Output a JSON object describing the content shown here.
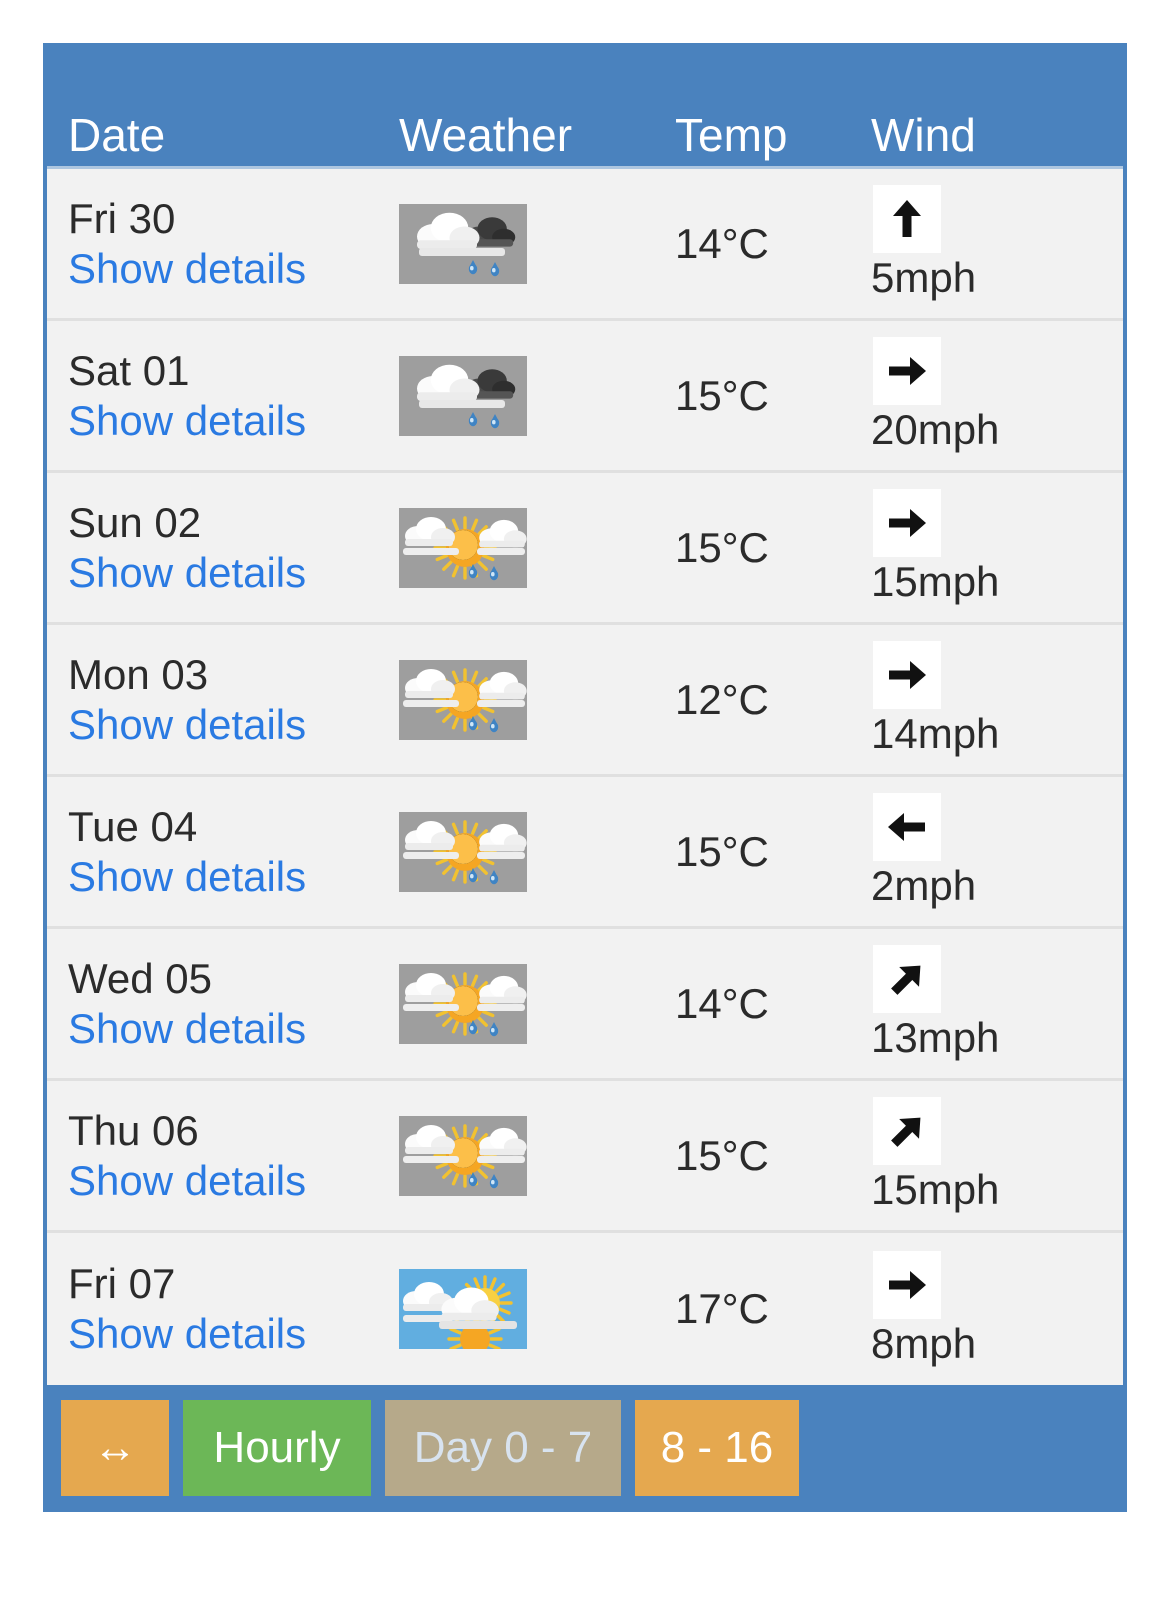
{
  "colors": {
    "header_bg": "#4a82be",
    "row_bg": "#f2f2f2",
    "link": "#2a7ae2",
    "orange": "#e5a84f",
    "green": "#6cb757",
    "tan": "#b6a98a"
  },
  "table": {
    "columns": [
      {
        "key": "date",
        "label": "Date"
      },
      {
        "key": "weather",
        "label": "Weather"
      },
      {
        "key": "temp",
        "label": "Temp"
      },
      {
        "key": "wind",
        "label": "Wind"
      }
    ],
    "rows": [
      {
        "date": "Fri 30",
        "details_label": "Show details",
        "weather_icon": "cloud-rain-icon",
        "temp": "14°C",
        "wind_icon": "arrow-up-icon",
        "wind_direction": "up",
        "wind_speed": "5mph"
      },
      {
        "date": "Sat 01",
        "details_label": "Show details",
        "weather_icon": "cloud-rain-icon",
        "temp": "15°C",
        "wind_icon": "arrow-right-icon",
        "wind_direction": "right",
        "wind_speed": "20mph"
      },
      {
        "date": "Sun 02",
        "details_label": "Show details",
        "weather_icon": "sun-cloud-rain-icon",
        "temp": "15°C",
        "wind_icon": "arrow-right-icon",
        "wind_direction": "right",
        "wind_speed": "15mph"
      },
      {
        "date": "Mon 03",
        "details_label": "Show details",
        "weather_icon": "sun-cloud-rain-icon",
        "temp": "12°C",
        "wind_icon": "arrow-right-icon",
        "wind_direction": "right",
        "wind_speed": "14mph"
      },
      {
        "date": "Tue 04",
        "details_label": "Show details",
        "weather_icon": "sun-cloud-rain-icon",
        "temp": "15°C",
        "wind_icon": "arrow-left-icon",
        "wind_direction": "left",
        "wind_speed": "2mph"
      },
      {
        "date": "Wed 05",
        "details_label": "Show details",
        "weather_icon": "sun-cloud-rain-icon",
        "temp": "14°C",
        "wind_icon": "arrow-up-right-icon",
        "wind_direction": "up-right",
        "wind_speed": "13mph"
      },
      {
        "date": "Thu 06",
        "details_label": "Show details",
        "weather_icon": "sun-cloud-rain-icon",
        "temp": "15°C",
        "wind_icon": "arrow-up-right-icon",
        "wind_direction": "up-right",
        "wind_speed": "15mph"
      },
      {
        "date": "Fri 07",
        "details_label": "Show details",
        "weather_icon": "sun-cloud-partly-icon",
        "temp": "17°C",
        "wind_icon": "arrow-right-icon",
        "wind_direction": "right",
        "wind_speed": "8mph"
      }
    ]
  },
  "footer": {
    "buttons": [
      {
        "name": "resize-button",
        "label": "↔",
        "icon": "resize-horizontal-icon",
        "style": "orange"
      },
      {
        "name": "hourly-button",
        "label": "Hourly",
        "icon": "",
        "style": "green"
      },
      {
        "name": "day-0-7-button",
        "label": "Day 0 - 7",
        "icon": "",
        "style": "tan"
      },
      {
        "name": "day-8-16-button",
        "label": "8 - 16",
        "icon": "",
        "style": "orange"
      }
    ]
  }
}
